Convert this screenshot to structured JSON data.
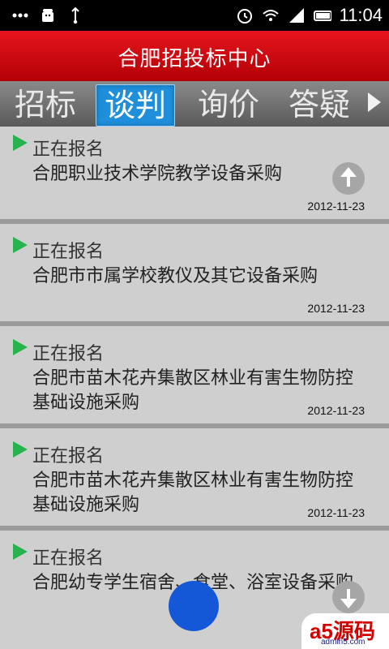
{
  "status_bar": {
    "time": "11:04",
    "icons": [
      "more-dots-icon",
      "android-icon",
      "usb-icon",
      "alarm-icon",
      "wifi-icon",
      "signal-icon",
      "battery-icon"
    ]
  },
  "header": {
    "title": "合肥招投标中心"
  },
  "tabs": [
    {
      "label": "招标"
    },
    {
      "label": "谈判",
      "active": true
    },
    {
      "label": "询价"
    },
    {
      "label": "答疑"
    }
  ],
  "list": {
    "items": [
      {
        "status": "正在报名",
        "title": "合肥职业技术学院教学设备采购",
        "date": "2012-11-23"
      },
      {
        "status": "正在报名",
        "title": "合肥市市属学校教仪及其它设备采购",
        "date": "2012-11-23"
      },
      {
        "status": "正在报名",
        "title": "合肥市苗木花卉集散区林业有害生物防控基础设施采购",
        "date": "2012-11-23"
      },
      {
        "status": "正在报名",
        "title": "合肥市苗木花卉集散区林业有害生物防控基础设施采购",
        "date": "2012-11-23"
      },
      {
        "status": "正在报名",
        "title": "合肥幼专学生宿舍、食堂、浴室设备采购",
        "date": ""
      }
    ]
  },
  "watermark": {
    "brand": "a5源码",
    "site": "admin5.com"
  },
  "colors": {
    "header_red": "#d0070e",
    "active_tab_blue": "#1f8edb",
    "status_green": "#27b34d"
  }
}
